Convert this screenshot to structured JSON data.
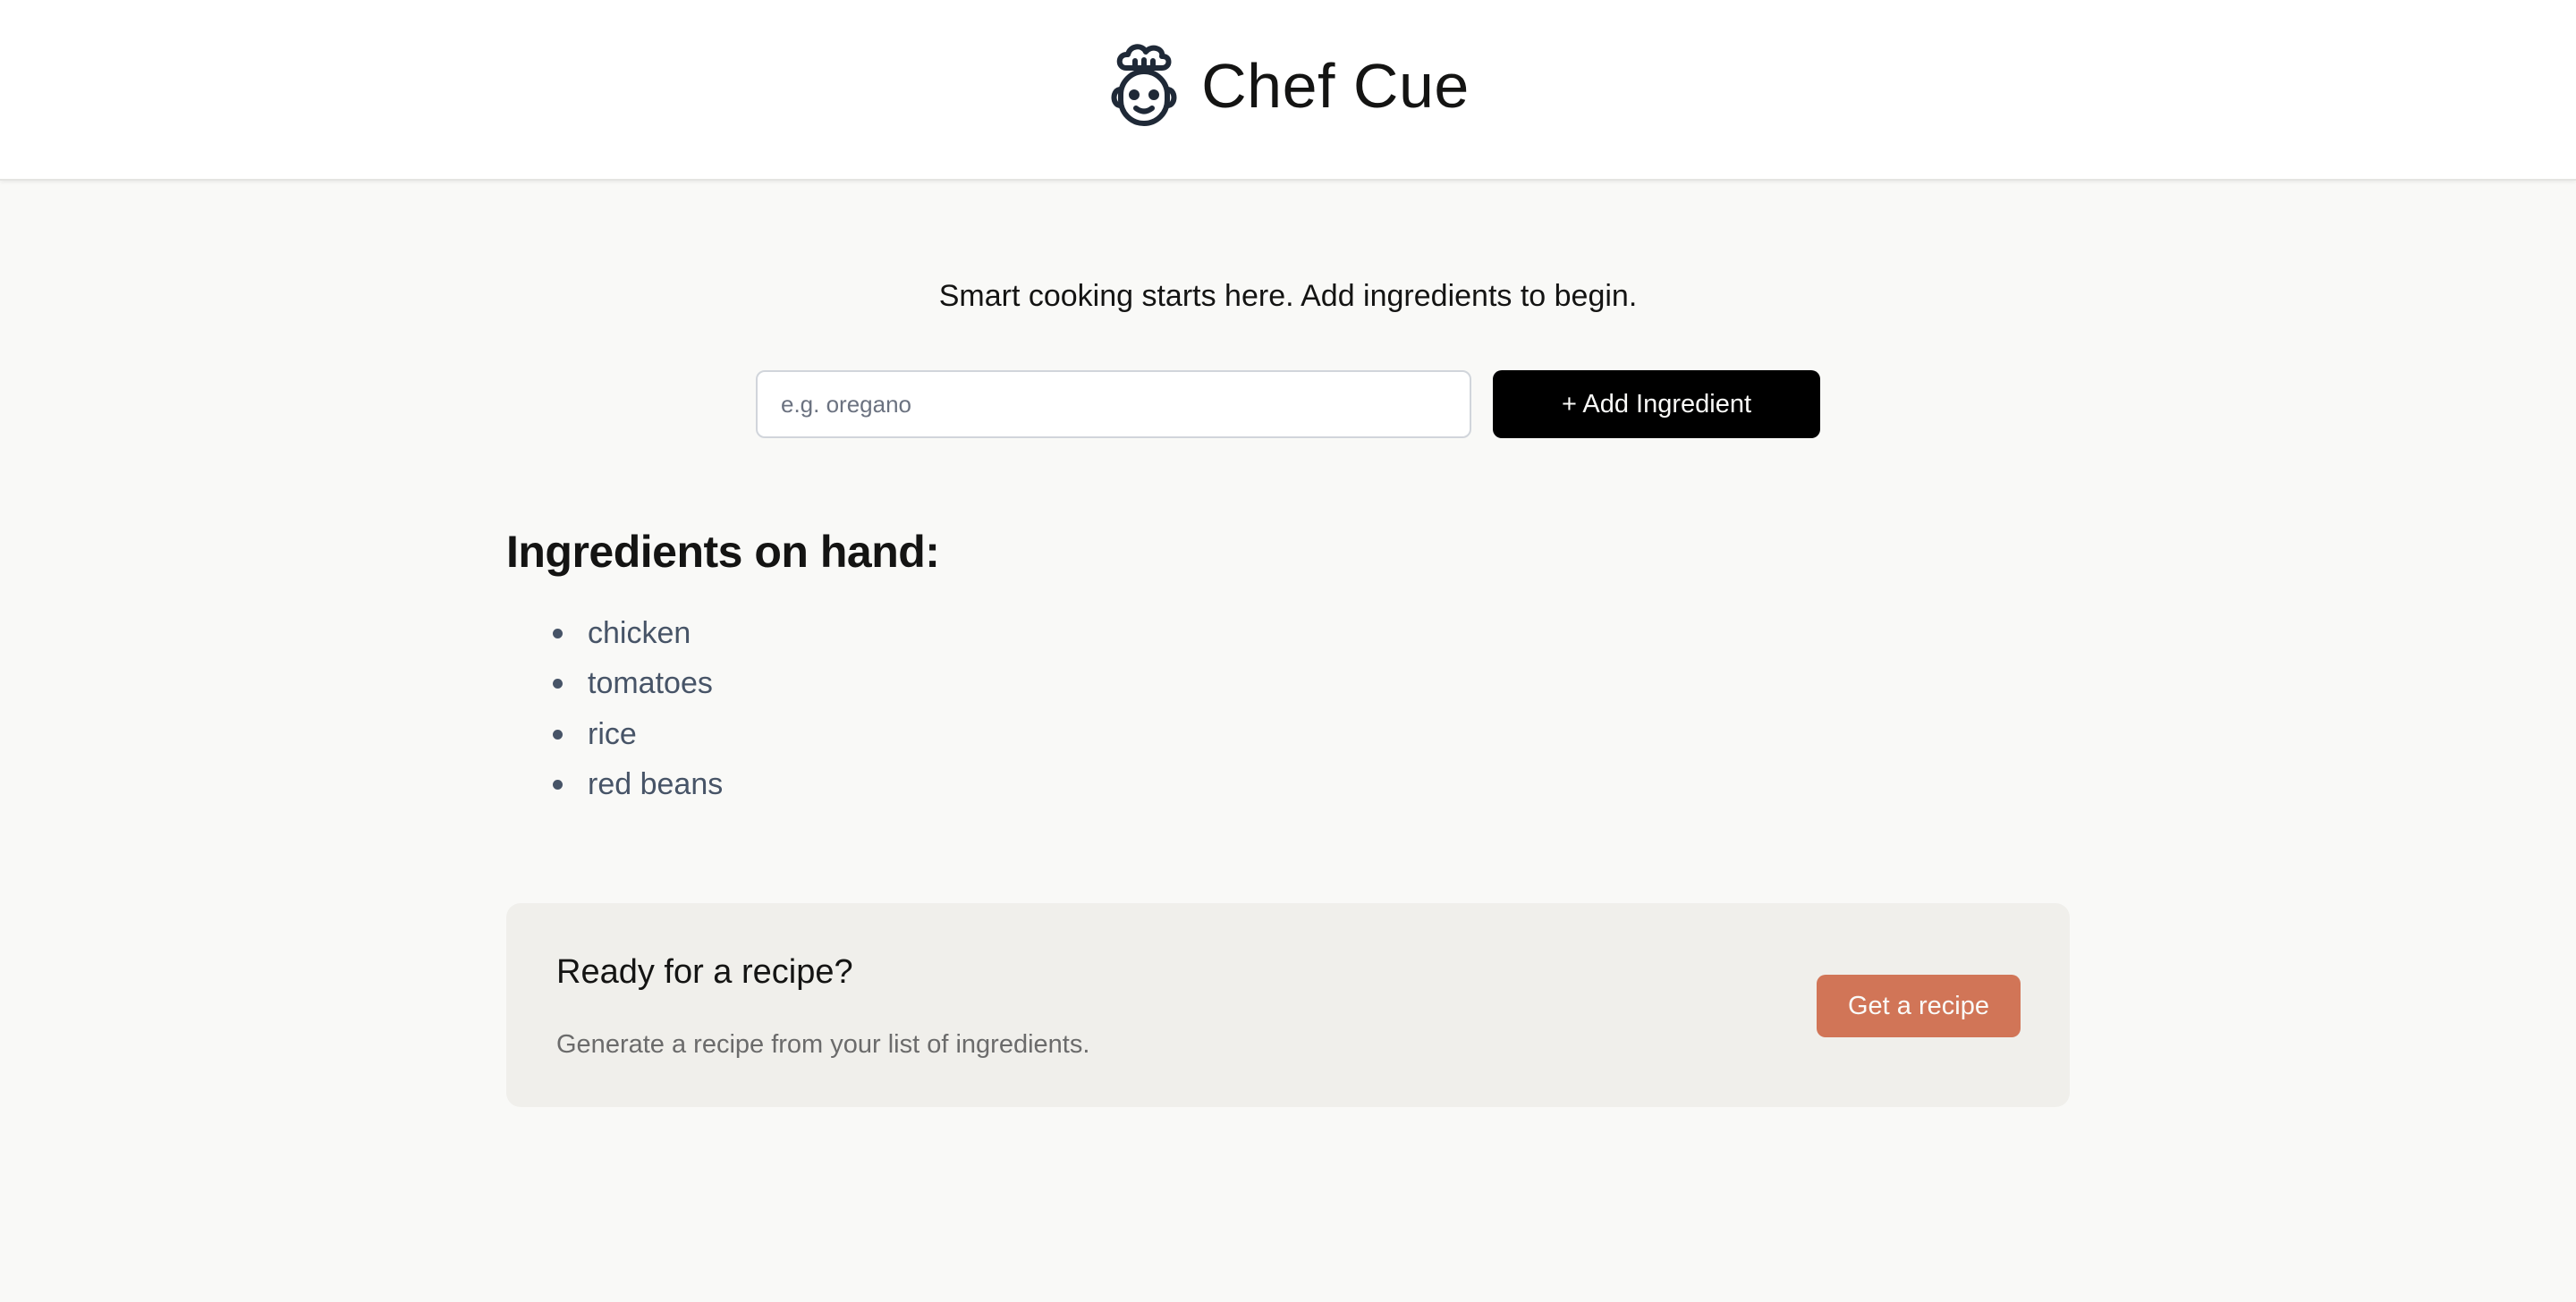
{
  "header": {
    "title": "Chef Cue",
    "logo_icon": "chef-face-icon"
  },
  "main": {
    "tagline": "Smart cooking starts here. Add ingredients to begin.",
    "input": {
      "placeholder": "e.g. oregano",
      "value": ""
    },
    "add_button_label": "+ Add Ingredient",
    "ingredients_heading": "Ingredients on hand:",
    "ingredients": [
      "chicken",
      "tomatoes",
      "rice",
      "red beans"
    ]
  },
  "recipe_card": {
    "heading": "Ready for a recipe?",
    "subtext": "Generate a recipe from your list of ingredients.",
    "button_label": "Get a recipe"
  },
  "colors": {
    "accent": "#d17557",
    "primary_button": "#000000",
    "background": "#f9f9f7",
    "card": "#f0efeb"
  }
}
